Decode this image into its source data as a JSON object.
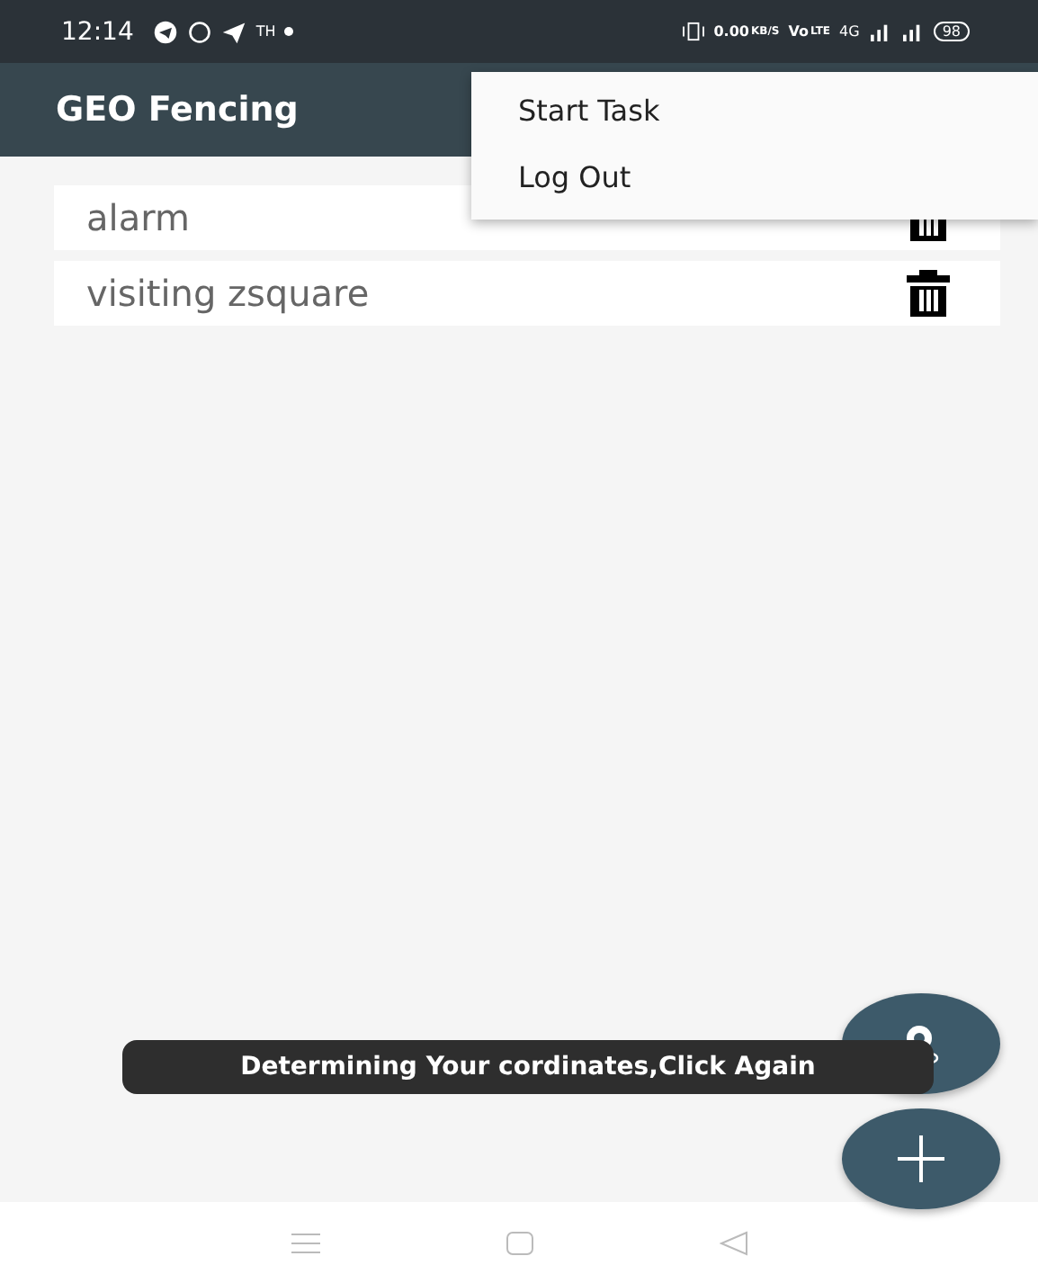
{
  "status_bar": {
    "time": "12:14",
    "carrier_text": "TH",
    "speed_value": "0.00",
    "speed_unit": "KB/S",
    "volte_top": "Vo",
    "volte_bottom": "LTE",
    "network": "4G",
    "battery": "98"
  },
  "app_bar": {
    "title": "GEO Fencing"
  },
  "menu": {
    "items": [
      {
        "label": "Start Task"
      },
      {
        "label": "Log Out"
      }
    ]
  },
  "geofences": [
    {
      "name": "alarm"
    },
    {
      "name": "visiting zsquare"
    }
  ],
  "toast": {
    "text": "Determining Your cordinates,Click Again"
  }
}
